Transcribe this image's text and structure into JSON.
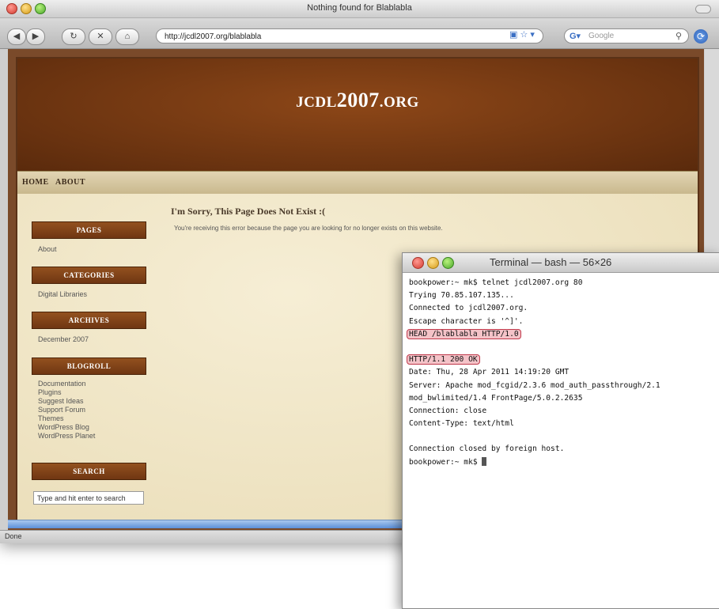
{
  "browser": {
    "window_title": "Nothing found for Blablabla",
    "url": "http://jcdl2007.org/blablabla",
    "search_placeholder": "Google",
    "status": "Done"
  },
  "site": {
    "title": "jcdl2007.org",
    "nav": [
      "Home",
      "About"
    ],
    "sidebar": {
      "pages_heading": "Pages",
      "pages": [
        "About"
      ],
      "categories_heading": "Categories",
      "categories": [
        "Digital Libraries"
      ],
      "archives_heading": "Archives",
      "archives": [
        "December 2007"
      ],
      "blogroll_heading": "Blogroll",
      "blogroll": [
        "Documentation",
        "Plugins",
        "Suggest Ideas",
        "Support Forum",
        "Themes",
        "WordPress Blog",
        "WordPress Planet"
      ],
      "search_heading": "Search",
      "search_value": "Type and hit enter to search"
    },
    "error_title": "I'm Sorry, This Page Does Not Exist :(",
    "error_message": "You're receiving this error because the page you are looking for no longer exists on this website."
  },
  "terminal": {
    "title": "Terminal — bash — 56×26",
    "lines": [
      "bookpower:~ mk$ telnet jcdl2007.org 80",
      "Trying 70.85.107.135...",
      "Connected to jcdl2007.org.",
      "Escape character is '^]'.",
      "HEAD /blablabla HTTP/1.0",
      "",
      "HTTP/1.1 200 OK",
      "Date: Thu, 28 Apr 2011 14:19:20 GMT",
      "Server: Apache mod_fcgid/2.3.6 mod_auth_passthrough/2.1",
      "mod_bwlimited/1.4 FrontPage/5.0.2.2635",
      "Connection: close",
      "Content-Type: text/html",
      "",
      "Connection closed by foreign host.",
      "bookpower:~ mk$ "
    ]
  }
}
